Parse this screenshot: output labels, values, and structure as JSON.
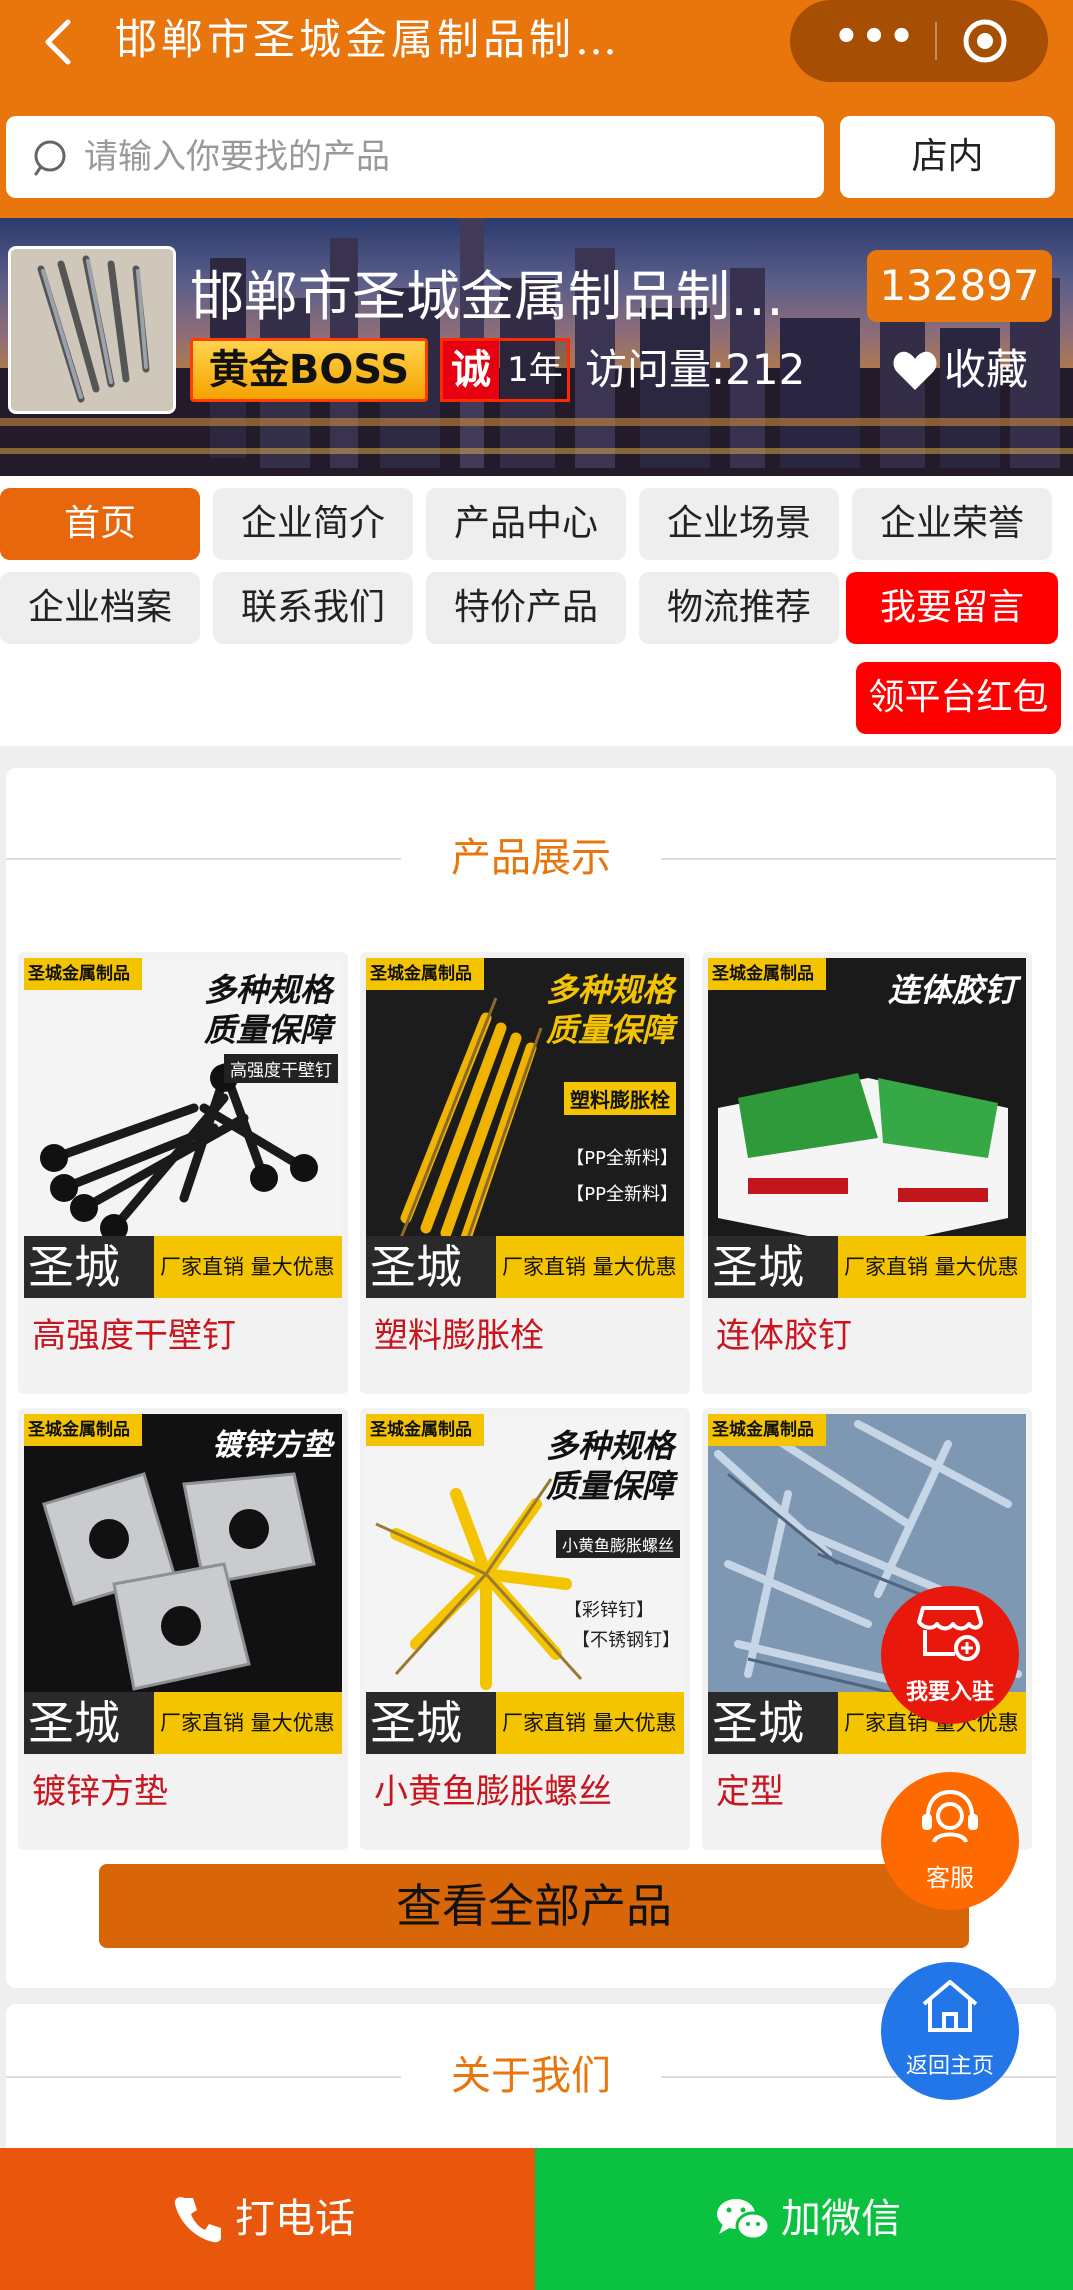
{
  "header": {
    "title": "邯郸市圣城金属制品制…",
    "more_icon": "more-dots-icon",
    "close_icon": "target-icon"
  },
  "search": {
    "placeholder": "请输入你要找的产品",
    "scope_button": "店内"
  },
  "banner": {
    "company_name": "邯郸市圣城金属制品制…",
    "count_badge": "132897",
    "membership_badge": "黄金BOSS",
    "credit_char": "诚",
    "credit_years": "1年",
    "visits": "访问量:212",
    "favorite_label": "收藏"
  },
  "nav": {
    "items": [
      {
        "label": "首页"
      },
      {
        "label": "企业简介"
      },
      {
        "label": "产品中心"
      },
      {
        "label": "企业场景"
      },
      {
        "label": "企业荣誉"
      },
      {
        "label": "企业档案"
      },
      {
        "label": "联系我们"
      },
      {
        "label": "特价产品"
      },
      {
        "label": "物流推荐"
      },
      {
        "label": "我要留言"
      },
      {
        "label": "领平台红包"
      }
    ]
  },
  "products_section": {
    "title": "产品展示",
    "view_all": "查看全部产品",
    "image_brand_tag": "圣城金属制品",
    "image_brand": "圣城",
    "image_promo": "厂家直销 量大优惠",
    "items": [
      {
        "name": "高强度干壁钉",
        "slogan": "多种规格\n质量保障",
        "sub": "高强度干壁钉"
      },
      {
        "name": "塑料膨胀栓",
        "slogan": "多种规格\n质量保障",
        "sub": "塑料膨胀栓",
        "tags": [
          "【PP全新料】",
          "【PP全新料】"
        ]
      },
      {
        "name": "连体胶钉",
        "slogan": "连体胶钉"
      },
      {
        "name": "镀锌方垫",
        "slogan": "镀锌方垫"
      },
      {
        "name": "小黄鱼膨胀螺丝",
        "slogan": "多种规格\n质量保障",
        "sub": "小黄鱼膨胀螺丝",
        "tags": [
          "【彩锌钉】",
          "【不锈钢钉】"
        ]
      },
      {
        "name": "定型"
      }
    ]
  },
  "about_section": {
    "title": "关于我们"
  },
  "floating": {
    "join": "我要入驻",
    "service": "客服",
    "home": "返回主页"
  },
  "bottom_bar": {
    "call": "打电话",
    "wechat": "加微信"
  },
  "colors": {
    "brand_orange": "#e8760c",
    "alert_red": "#ff0000",
    "wechat_green": "#0bc240"
  }
}
